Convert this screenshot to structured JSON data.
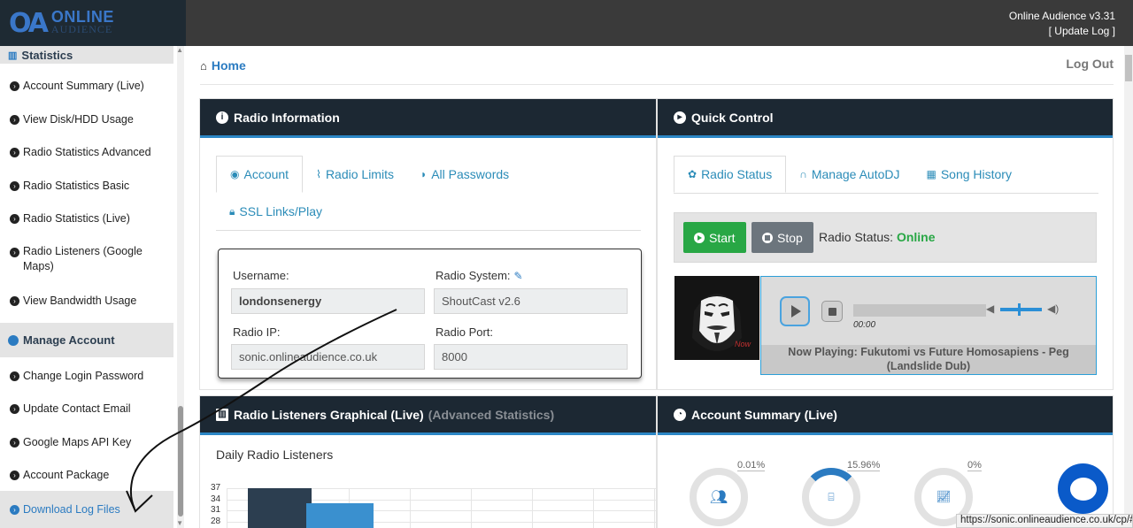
{
  "brand": {
    "mark": "OA",
    "line1": "ONLINE",
    "line2": "AUDIENCE"
  },
  "header": {
    "version": "Online Audience v3.31",
    "update_log": "[ Update Log ]"
  },
  "sidebar": {
    "statistics_section": "Statistics",
    "stats_items": [
      {
        "label": "Account Summary (Live)"
      },
      {
        "label": "View Disk/HDD Usage"
      },
      {
        "label": "Radio Statistics Advanced"
      },
      {
        "label": "Radio Statistics Basic"
      },
      {
        "label": "Radio Statistics (Live)"
      },
      {
        "label": "Radio Listeners (Google Maps)"
      },
      {
        "label": "View Bandwidth Usage"
      }
    ],
    "manage_section": "Manage Account",
    "manage_items": [
      {
        "label": "Change Login Password"
      },
      {
        "label": "Update Contact Email"
      },
      {
        "label": "Google Maps API Key"
      },
      {
        "label": "Account Package"
      },
      {
        "label": "Download Log Files"
      }
    ]
  },
  "breadcrumb": {
    "home": "Home"
  },
  "logout": "Log Out",
  "radio_info": {
    "title": "Radio Information",
    "tabs": [
      "Account",
      "Radio Limits",
      "All Passwords",
      "SSL Links/Play"
    ],
    "username_label": "Username:",
    "username": "londonsenergy",
    "system_label": "Radio System:",
    "system": "ShoutCast v2.6",
    "ip_label": "Radio IP:",
    "ip": "sonic.onlineaudience.co.uk",
    "port_label": "Radio Port:",
    "port": "8000"
  },
  "quick_control": {
    "title": "Quick Control",
    "tabs": [
      "Radio Status",
      "Manage AutoDJ",
      "Song History"
    ],
    "start": "Start",
    "stop": "Stop",
    "status_label": "Radio Status:",
    "status_value": "Online",
    "time": "00:00",
    "now_playing": "Now Playing: Fukutomi vs Future Homosapiens - Peg (Landslide Dub)",
    "cover_text": "Now"
  },
  "listeners": {
    "title": "Radio Listeners Graphical (Live)",
    "subtitle": "(Advanced Statistics)",
    "chart_title": "Daily Radio Listeners"
  },
  "chart_data": {
    "type": "bar",
    "title": "Daily Radio Listeners",
    "yticks": [
      37,
      34,
      31,
      28
    ],
    "series": [
      {
        "values": [
          37
        ],
        "color": "#2c3e50"
      },
      {
        "values": [
          33
        ],
        "color": "#3a90cf"
      }
    ]
  },
  "account_summary": {
    "title": "Account Summary (Live)",
    "gauges": [
      {
        "value": "0.01%",
        "icon": "users-icon",
        "fraction": 0.0001
      },
      {
        "value": "15.96%",
        "icon": "hdd-icon",
        "fraction": 0.1596
      },
      {
        "value": "0%",
        "icon": "chart-icon",
        "fraction": 0
      }
    ]
  },
  "status_url": "https://sonic.onlineaudience.co.uk/cp/#"
}
